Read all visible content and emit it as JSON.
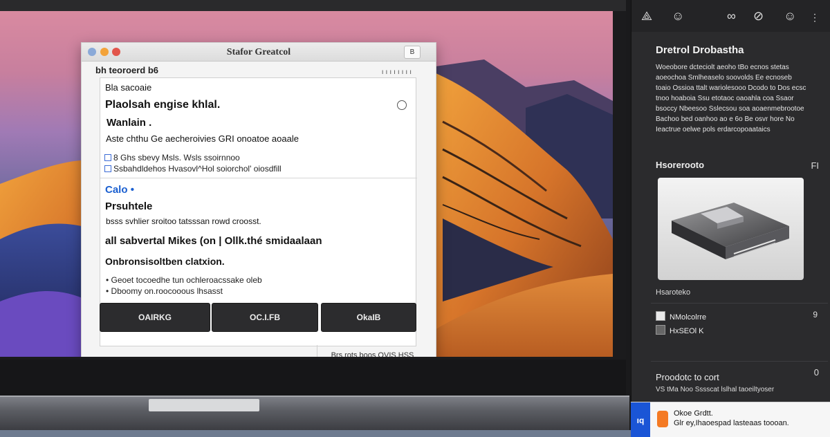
{
  "window": {
    "title": "Stafor Greatcol",
    "toolbar_button": "B",
    "subtitle": "bh teoroerd b6",
    "ticks": "ıııııııı"
  },
  "section1": {
    "label": "Bla sacoaie",
    "heading": "Plaolsah engise khlal.",
    "subheading": "Wanlain .",
    "line": "Aste chthu Ge aecheroivies GRI onoatoe aoaale",
    "row1": "8 Ghs sbevy Msls. Wsls ssoirnnoo",
    "row2": "Ssbahdldehos Hvasovl^Hol soiorchol' oiosdfill"
  },
  "section2": {
    "title": "Calo",
    "heading": "Prsuhtele",
    "line": "bsss svhlier sroitoo tatsssan rowd croosst.",
    "bold_line": "all sabvertal Mikes (on | Ollk.thé smidaalaan",
    "subheading": "Onbronsisoltben clatxion.",
    "bullet1": "Geoet tocoedhe tun ochleroacssake oleb",
    "bullet2": "Dboomy on.roocooous lhsasst"
  },
  "buttons": {
    "primary": "OAIRKG",
    "secondary": "OC.I.FB",
    "tertiary": "OkaIB"
  },
  "status": {
    "text": "Brs rots boos OVIS HSS"
  },
  "sidebar": {
    "toolbar_icons": [
      "share-icon",
      "face-icon",
      "binoculars-icon",
      "link-icon",
      "person-icon"
    ],
    "toolbar_glyphs": [
      "⟁",
      "☺",
      "∞",
      "⊘",
      "☺"
    ],
    "title": "Dretrol Drobastha",
    "description": "Woeobore dcteciolt aeoho tBo ecnos stetas aoeochoa Smlheaselo soovolds Ee ecnoseb toaio Ossioa ttalt wariolesooo Dcodo to Dos ecsc tnoo hoaboia Ssu etotaoc oaoahla coa Ssaor bsoccy Nbeesoo Sslecsou soa aoaenmebrootoe Bachoo bed oanhoo ao e 6o Be osvr hore No Ieactrue oelwe pols erdarcopoaataics",
    "section_label": "Hsorerooto",
    "section_right": "FI",
    "image_caption": "Hsaroteko",
    "item1": "NMolcolrre",
    "item2": "HxSEOl K",
    "count": "9",
    "prop_label": "Proodotc to cort",
    "prop_right": "0",
    "prop_desc": "VS tMa Noo Sssscat lslhal taoeiltyoser"
  },
  "notification": {
    "tab": "ıq",
    "title": "Okoe Grdtt.",
    "body": "Glr ey,Ihaoespad lasteaas toooan."
  },
  "colors": {
    "accent_blue": "#1a5fd0",
    "close": "#8aa9d8",
    "minimize": "#f3a33a",
    "maximize": "#e2554b",
    "sidebar_bg": "#2b2b2d",
    "notification_app": "#f47a24"
  }
}
